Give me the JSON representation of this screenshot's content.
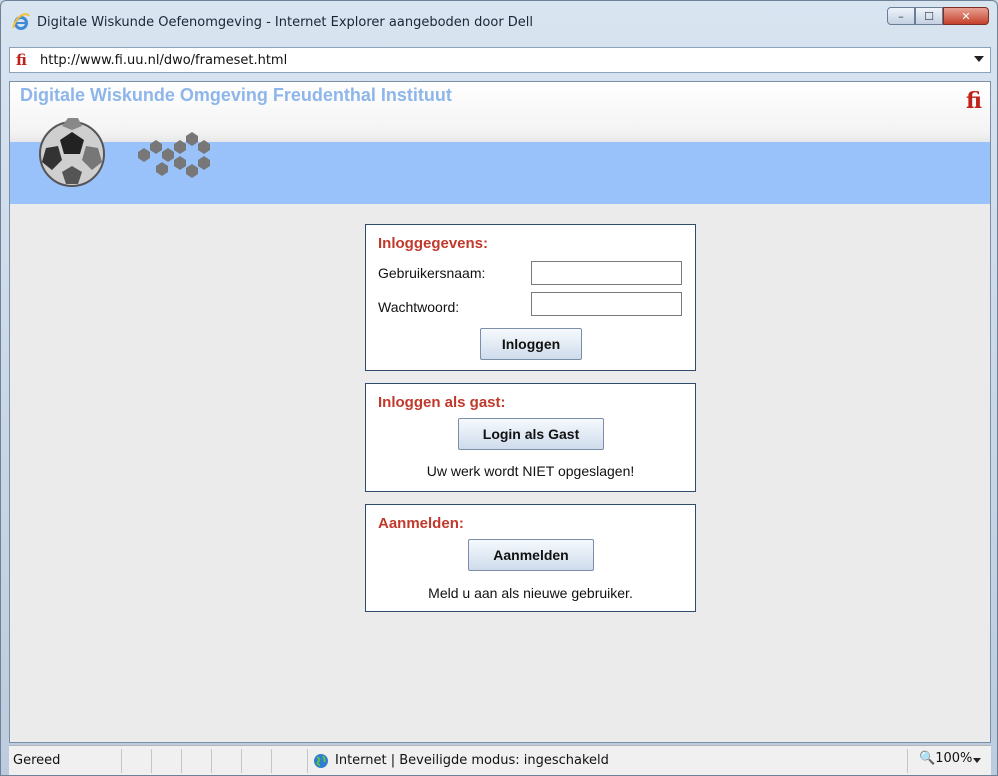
{
  "window": {
    "title": "Digitale Wiskunde Oefenomgeving - Internet Explorer aangeboden door Dell",
    "controls": {
      "minimize": "–",
      "maximize": "☐",
      "close": "✕"
    }
  },
  "address": {
    "url": "http://www.fi.uu.nl/dwo/frameset.html",
    "site_icon": "fi-logo-icon"
  },
  "header": {
    "title": "Digitale Wiskunde Omgeving  Freudenthal Instituut",
    "logo": "fi"
  },
  "login": {
    "title": "Inloggegevens:",
    "username_label": "Gebruikersnaam:",
    "username_value": "",
    "password_label": "Wachtwoord:",
    "password_value": "",
    "submit_label": "Inloggen"
  },
  "guest": {
    "title": "Inloggen als gast:",
    "button_label": "Login als Gast",
    "note": "Uw werk wordt NIET opgeslagen!"
  },
  "register": {
    "title": "Aanmelden:",
    "button_label": "Aanmelden",
    "note": "Meld u aan als nieuwe gebruiker."
  },
  "status": {
    "left": "Gereed",
    "zone": "Internet | Beveiligde modus: ingeschakeld",
    "zoom": "100%"
  },
  "colors": {
    "accent": "#c0392b",
    "header_band": "#99c2fb",
    "header_title": "#8eb6ea",
    "panel_border": "#2f4b6e"
  }
}
